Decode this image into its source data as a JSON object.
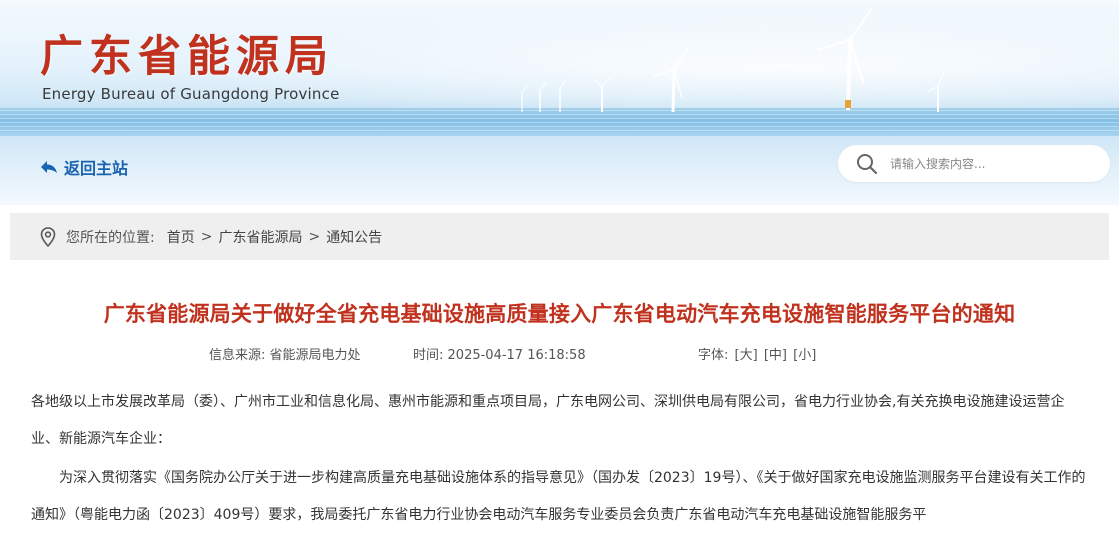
{
  "header": {
    "title": "广东省能源局",
    "subtitle": "Energy Bureau of Guangdong Province",
    "back_label": "返回主站",
    "search_placeholder": "请输入搜索内容..."
  },
  "breadcrumb": {
    "label": "您所在的位置:",
    "items": [
      "首页",
      "广东省能源局",
      "通知公告"
    ],
    "separator": ">"
  },
  "article": {
    "title": "广东省能源局关于做好全省充电基础设施高质量接入广东省电动汽车充电设施智能服务平台的通知",
    "source_label": "信息来源:",
    "source": "省能源局电力处",
    "time_label": "时间:",
    "time": "2025-04-17 16:18:58",
    "font_label": "字体:",
    "font_sizes": [
      "[大]",
      "[中]",
      "[小]"
    ],
    "paragraphs": [
      "各地级以上市发展改革局（委）、广州市工业和信息化局、惠州市能源和重点项目局，广东电网公司、深圳供电局有限公司，省电力行业协会,有关充换电设施建设运营企业、新能源汽车企业：",
      "为深入贯彻落实《国务院办公厅关于进一步构建高质量充电基础设施体系的指导意见》（国办发〔2023〕19号）、《关于做好国家充电设施监测服务平台建设有关工作的通知》（粤能电力函〔2023〕409号）要求，我局委托广东省电力行业协会电动汽车服务专业委员会负责广东省电动汽车充电基础设施智能服务平"
    ]
  },
  "colors": {
    "title_red": "#c0311e",
    "link_blue": "#1a63b0",
    "breadcrumb_bg": "#efefef"
  },
  "icons": {
    "back": "arrow-back-icon",
    "search": "search-icon",
    "location": "location-pin-icon"
  }
}
